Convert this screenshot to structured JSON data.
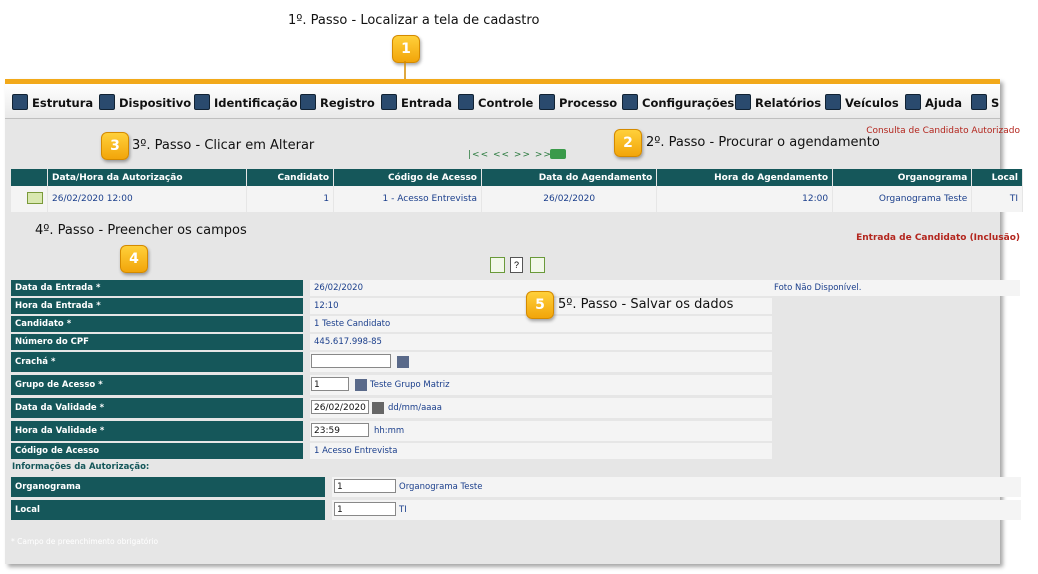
{
  "annotations": {
    "step1": "1º. Passo - Localizar a tela de cadastro",
    "step2": "2º. Passo - Procurar o agendamento",
    "step3": "3º. Passo - Clicar em Alterar",
    "step4": "4º. Passo - Preencher os campos",
    "step5": "5º. Passo - Salvar os dados",
    "callouts": [
      "1",
      "2",
      "3",
      "4",
      "5"
    ]
  },
  "menu": {
    "items": [
      {
        "label": "Estrutura",
        "icon": "structure-icon"
      },
      {
        "label": "Dispositivo",
        "icon": "device-icon"
      },
      {
        "label": "Identificação",
        "icon": "identification-icon"
      },
      {
        "label": "Registro",
        "icon": "register-icon"
      },
      {
        "label": "Entrada",
        "icon": "entry-icon"
      },
      {
        "label": "Controle",
        "icon": "control-icon"
      },
      {
        "label": "Processo",
        "icon": "process-icon"
      },
      {
        "label": "Configurações",
        "icon": "settings-icon"
      },
      {
        "label": "Relatórios",
        "icon": "reports-icon"
      },
      {
        "label": "Veículos",
        "icon": "vehicles-icon"
      },
      {
        "label": "Ajuda",
        "icon": "help-icon"
      },
      {
        "label": "S",
        "icon": "exit-icon"
      }
    ]
  },
  "consulta": {
    "title": "Consulta de Candidato Autorizado",
    "pager": "|<< << >> >>|",
    "columns": [
      "Data/Hora da Autorização",
      "Candidato",
      "Código de Acesso",
      "Data do Agendamento",
      "Hora do Agendamento",
      "Organograma",
      "Local"
    ],
    "row": [
      "26/02/2020 12:00",
      "1",
      "1 - Acesso Entrevista",
      "26/02/2020",
      "12:00",
      "Organograma Teste",
      "TI"
    ]
  },
  "form": {
    "title": "Entrada de Candidato (Inclusão)",
    "photo": "Foto Não Disponível.",
    "fields": {
      "data_entrada": {
        "label": "Data da Entrada *",
        "value": "26/02/2020"
      },
      "hora_entrada": {
        "label": "Hora da Entrada *",
        "value": "12:10"
      },
      "candidato": {
        "label": "Candidato *",
        "value": "1 Teste Candidato"
      },
      "cpf": {
        "label": "Número do CPF",
        "value": "445.617.998-85"
      },
      "cracha": {
        "label": "Crachá *",
        "value": ""
      },
      "grupo": {
        "label": "Grupo de Acesso *",
        "value": "1",
        "desc": "Teste Grupo Matriz"
      },
      "validade_data": {
        "label": "Data da Validade *",
        "value": "26/02/2020",
        "hint": "dd/mm/aaaa"
      },
      "validade_hora": {
        "label": "Hora da Validade *",
        "value": "23:59",
        "hint": "hh:mm"
      },
      "codigo": {
        "label": "Código de Acesso",
        "value": "1 Acesso Entrevista"
      }
    },
    "auth_section": "Informações da Autorização:",
    "organograma": {
      "label": "Organograma",
      "value": "1",
      "desc": "Organograma Teste"
    },
    "local": {
      "label": "Local",
      "value": "1",
      "desc": "TI"
    },
    "footnote": "* Campo de preenchimento obrigatório"
  }
}
